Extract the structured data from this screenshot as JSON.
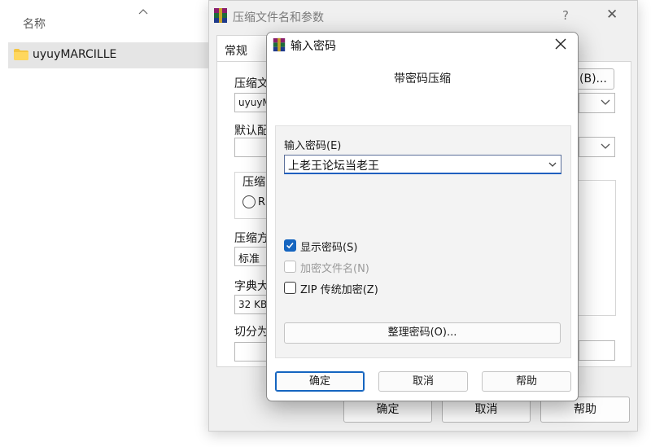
{
  "explorer": {
    "column_header": "名称",
    "file_name": "uyuyMARCILLE"
  },
  "archive_dialog": {
    "title": "压缩文件名和参数",
    "help_glyph": "?",
    "close_glyph": "✕",
    "tab_general": "常规",
    "archive_name_label": "压缩文",
    "archive_name_value": "uyuyM",
    "browse_button_suffix": "(B)...",
    "default_profile_label": "默认配",
    "format_group_label": "压缩",
    "format_option": "R",
    "method_label": "压缩方",
    "method_value": "标准",
    "dictionary_label": "字典大",
    "dictionary_value": "32 KB",
    "split_label": "切分为",
    "ok_button": "确定",
    "cancel_button": "取消",
    "help_button": "帮助"
  },
  "password_dialog": {
    "title": "输入密码",
    "heading": "带密码压缩",
    "password_label": "输入密码(E)",
    "password_value": "上老王论坛当老王",
    "options": [
      {
        "label": "显示密码(S)",
        "checked": true,
        "disabled": false
      },
      {
        "label": "加密文件名(N)",
        "checked": false,
        "disabled": true
      },
      {
        "label": "ZIP 传统加密(Z)",
        "checked": false,
        "disabled": false
      }
    ],
    "organize_button": "整理密码(O)...",
    "ok_button": "确定",
    "cancel_button": "取消",
    "help_button": "帮助"
  }
}
